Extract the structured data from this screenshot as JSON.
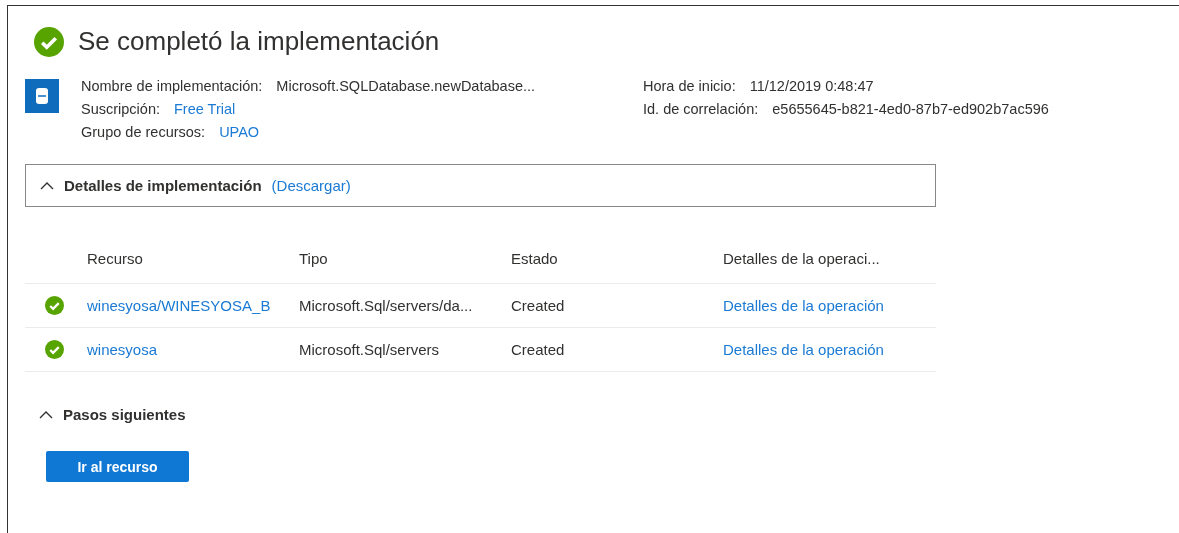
{
  "header": {
    "title": "Se completó la implementación"
  },
  "summary": {
    "left": [
      {
        "label": "Nombre de implementación:",
        "value": "Microsoft.SQLDatabase.newDatabase...",
        "link": false
      },
      {
        "label": "Suscripción:",
        "value": "Free Trial",
        "link": true
      },
      {
        "label": "Grupo de recursos:",
        "value": "UPAO",
        "link": true
      }
    ],
    "right": [
      {
        "label": "Hora de inicio:",
        "value": "11/12/2019 0:48:47",
        "link": false
      },
      {
        "label": "Id. de correlación:",
        "value": "e5655645-b821-4ed0-87b7-ed902b7ac596",
        "link": false
      }
    ]
  },
  "details": {
    "title": "Detalles de implementación",
    "link": "(Descargar)",
    "expanded": true,
    "columns": [
      "Recurso",
      "Tipo",
      "Estado",
      "Detalles de la operaci..."
    ],
    "rows": [
      {
        "resource": "winesyosa/WINESYOSA_B",
        "type": "Microsoft.Sql/servers/da...",
        "status": "Created",
        "operation": "Detalles de la operación"
      },
      {
        "resource": "winesyosa",
        "type": "Microsoft.Sql/servers",
        "status": "Created",
        "operation": "Detalles de la operación"
      }
    ]
  },
  "next_steps": {
    "title": "Pasos siguientes",
    "expanded": true,
    "button": "Ir al recurso"
  }
}
